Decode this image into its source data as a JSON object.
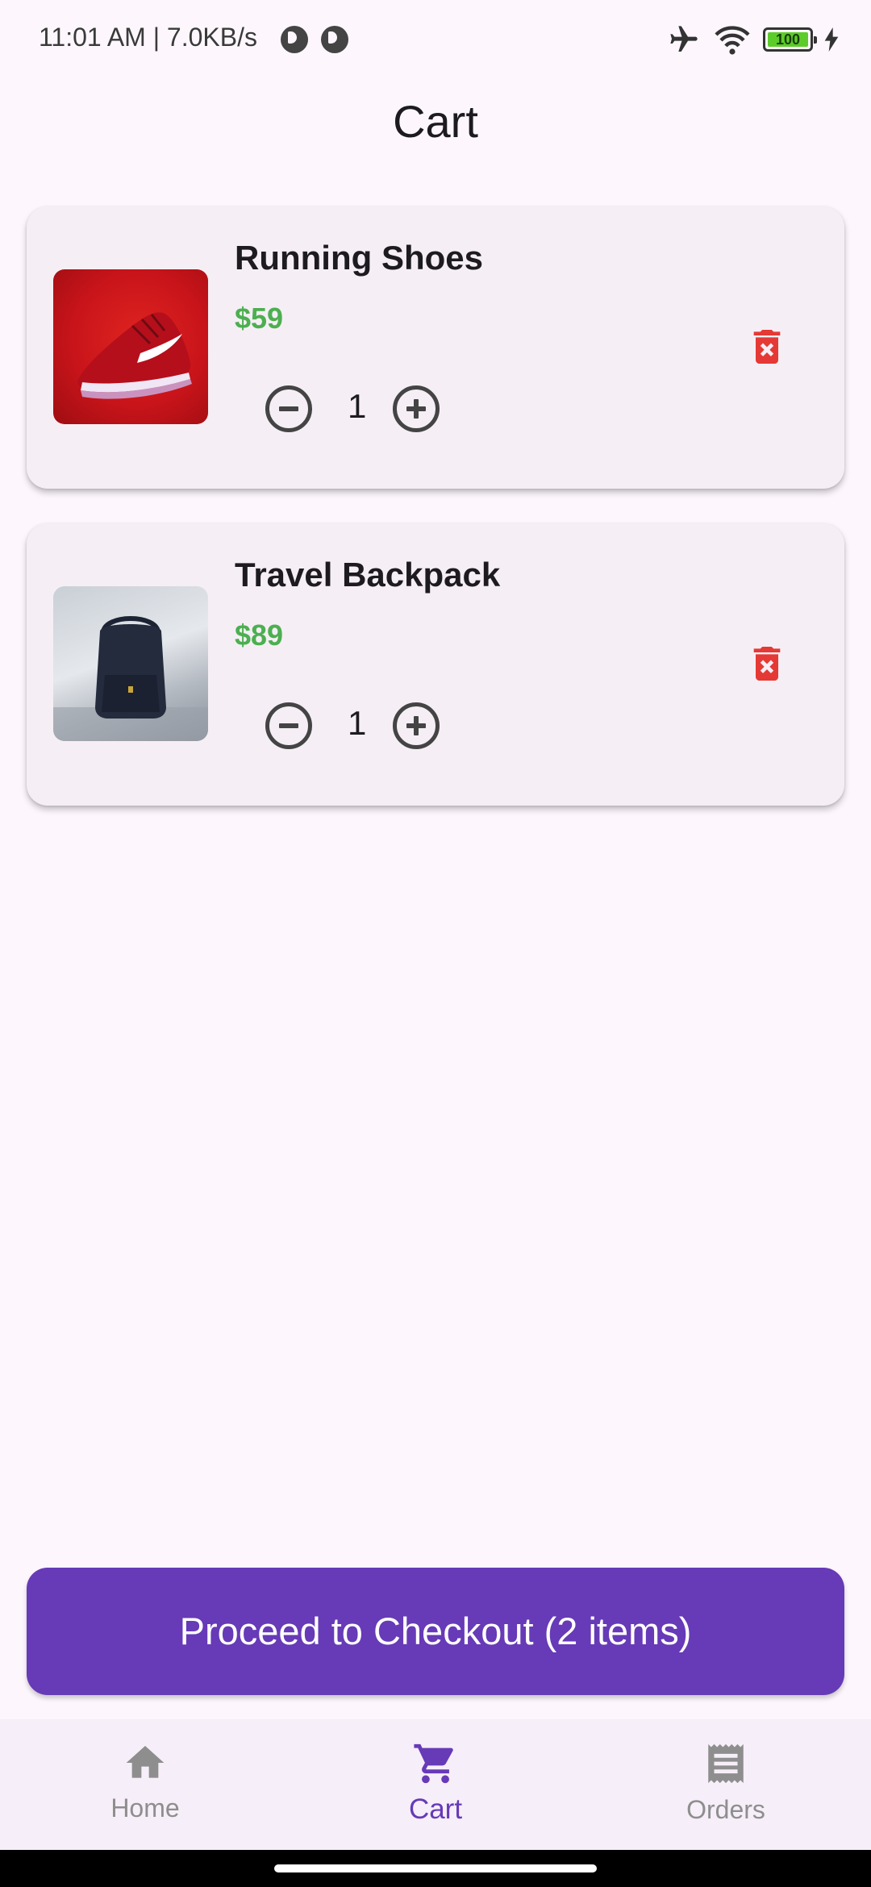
{
  "status_bar": {
    "time": "11:01 AM | 7.0KB/s",
    "battery": "100"
  },
  "page": {
    "title": "Cart"
  },
  "cart_items": [
    {
      "name": "Running Shoes",
      "price": "$59",
      "quantity": "1",
      "image": "red running shoe"
    },
    {
      "name": "Travel Backpack",
      "price": "$89",
      "quantity": "1",
      "image": "navy backpack"
    }
  ],
  "checkout": {
    "label": "Proceed to Checkout (2 items)"
  },
  "nav": {
    "items": [
      {
        "label": "Home",
        "icon": "home-icon"
      },
      {
        "label": "Cart",
        "icon": "cart-icon",
        "active": true
      },
      {
        "label": "Orders",
        "icon": "receipt-icon"
      }
    ]
  },
  "colors": {
    "accent": "#673ab7",
    "price": "#4caf50",
    "delete": "#e53935",
    "background": "#fdf7fd",
    "card": "#f5eff5"
  }
}
